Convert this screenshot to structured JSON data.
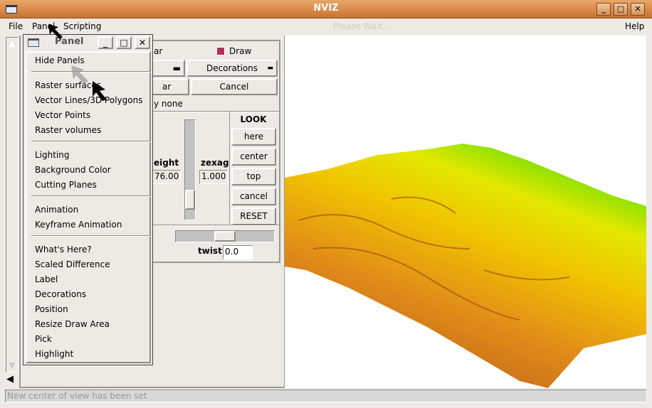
{
  "window": {
    "title": "NVIZ",
    "min": "_",
    "max": "□",
    "close": "✕"
  },
  "menubar": {
    "items": [
      "File",
      "Panel",
      "Scripting"
    ],
    "help": "Help",
    "status": "Please Wait..."
  },
  "panel": {
    "title": "Panel",
    "items": [
      "Hide Panels",
      "Raster surfaces",
      "Vector Lines/3D Polygons",
      "Vector Points",
      "Raster volumes",
      "Lighting",
      "Background Color",
      "Cutting Planes",
      "Animation",
      "Keyframe Animation",
      "What's Here?",
      "Scaled Difference",
      "Label",
      "Decorations",
      "Position",
      "Resize Draw Area",
      "Pick",
      "Highlight"
    ]
  },
  "controls": {
    "clear_partial": "ar",
    "draw_label": "Draw",
    "draw_checked": true,
    "decorations": "Decorations",
    "clear_btn_partial": "ar",
    "cancel": "Cancel",
    "by_partial": "y none",
    "height_label_partial": "eight",
    "height_value": "76.00",
    "zexag_label": "zexag",
    "zexag_value": "1.000",
    "zexag_slider_fraction": 0.8,
    "look": {
      "title": "LOOK",
      "buttons": [
        "here",
        "center",
        "top",
        "cancel",
        "RESET"
      ]
    },
    "twist_label": "twist",
    "twist_value": "0.0",
    "twist_slider_fraction": 0.5
  },
  "statusbar": {
    "message": "New center of view has been set"
  },
  "colors": {
    "titlebar": "#d9863f",
    "terrain_low": "#d2691e",
    "terrain_mid": "#f0c000",
    "terrain_high": "#7de000",
    "draw_check": "#b0305a"
  }
}
